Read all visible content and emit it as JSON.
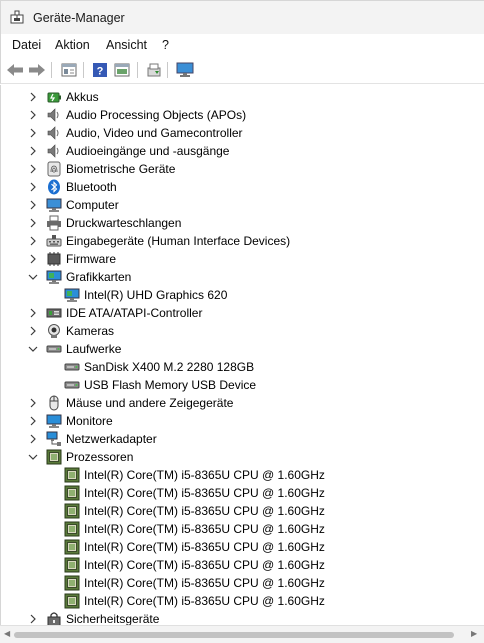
{
  "window": {
    "title": "Geräte-Manager"
  },
  "menu": {
    "items": [
      "Datei",
      "Aktion",
      "Ansicht",
      "?"
    ]
  },
  "toolbar": {
    "buttons": [
      "back-arrow-icon",
      "forward-arrow-icon",
      "properties-icon",
      "help-icon",
      "view-icon",
      "update-driver-icon",
      "monitor-icon"
    ]
  },
  "tree": [
    {
      "label": "Akkus",
      "level": 0,
      "expanded": false,
      "icon": "battery-icon"
    },
    {
      "label": "Audio Processing Objects (APOs)",
      "level": 0,
      "expanded": false,
      "icon": "speaker-icon"
    },
    {
      "label": "Audio, Video und Gamecontroller",
      "level": 0,
      "expanded": false,
      "icon": "speaker-icon"
    },
    {
      "label": "Audioeingänge und -ausgänge",
      "level": 0,
      "expanded": false,
      "icon": "speaker-icon"
    },
    {
      "label": "Biometrische Geräte",
      "level": 0,
      "expanded": false,
      "icon": "fingerprint-icon"
    },
    {
      "label": "Bluetooth",
      "level": 0,
      "expanded": false,
      "icon": "bluetooth-icon"
    },
    {
      "label": "Computer",
      "level": 0,
      "expanded": false,
      "icon": "computer-icon"
    },
    {
      "label": "Druckwarteschlangen",
      "level": 0,
      "expanded": false,
      "icon": "printer-icon"
    },
    {
      "label": "Eingabegeräte (Human Interface Devices)",
      "level": 0,
      "expanded": false,
      "icon": "hid-icon"
    },
    {
      "label": "Firmware",
      "level": 0,
      "expanded": false,
      "icon": "firmware-icon"
    },
    {
      "label": "Grafikkarten",
      "level": 0,
      "expanded": true,
      "icon": "display-adapter-icon"
    },
    {
      "label": "Intel(R) UHD Graphics 620",
      "level": 1,
      "icon": "display-adapter-icon"
    },
    {
      "label": "IDE ATA/ATAPI-Controller",
      "level": 0,
      "expanded": false,
      "icon": "ide-controller-icon"
    },
    {
      "label": "Kameras",
      "level": 0,
      "expanded": false,
      "icon": "camera-icon"
    },
    {
      "label": "Laufwerke",
      "level": 0,
      "expanded": true,
      "icon": "drive-icon"
    },
    {
      "label": "SanDisk X400 M.2 2280 128GB",
      "level": 1,
      "icon": "drive-icon"
    },
    {
      "label": "USB Flash Memory USB Device",
      "level": 1,
      "icon": "drive-icon"
    },
    {
      "label": "Mäuse und andere Zeigegeräte",
      "level": 0,
      "expanded": false,
      "icon": "mouse-icon"
    },
    {
      "label": "Monitore",
      "level": 0,
      "expanded": false,
      "icon": "monitor-icon"
    },
    {
      "label": "Netzwerkadapter",
      "level": 0,
      "expanded": false,
      "icon": "network-adapter-icon"
    },
    {
      "label": "Prozessoren",
      "level": 0,
      "expanded": true,
      "icon": "processor-icon"
    },
    {
      "label": "Intel(R) Core(TM) i5-8365U CPU @ 1.60GHz",
      "level": 1,
      "icon": "processor-icon"
    },
    {
      "label": "Intel(R) Core(TM) i5-8365U CPU @ 1.60GHz",
      "level": 1,
      "icon": "processor-icon"
    },
    {
      "label": "Intel(R) Core(TM) i5-8365U CPU @ 1.60GHz",
      "level": 1,
      "icon": "processor-icon"
    },
    {
      "label": "Intel(R) Core(TM) i5-8365U CPU @ 1.60GHz",
      "level": 1,
      "icon": "processor-icon"
    },
    {
      "label": "Intel(R) Core(TM) i5-8365U CPU @ 1.60GHz",
      "level": 1,
      "icon": "processor-icon"
    },
    {
      "label": "Intel(R) Core(TM) i5-8365U CPU @ 1.60GHz",
      "level": 1,
      "icon": "processor-icon"
    },
    {
      "label": "Intel(R) Core(TM) i5-8365U CPU @ 1.60GHz",
      "level": 1,
      "icon": "processor-icon"
    },
    {
      "label": "Intel(R) Core(TM) i5-8365U CPU @ 1.60GHz",
      "level": 1,
      "icon": "processor-icon"
    },
    {
      "label": "Sicherheitsgeräte",
      "level": 0,
      "expanded": false,
      "icon": "security-device-icon"
    }
  ],
  "colors": {
    "accent": "#0067c0",
    "title_bg": "#f3f3f3",
    "chip_green": "#5a7a3a"
  }
}
